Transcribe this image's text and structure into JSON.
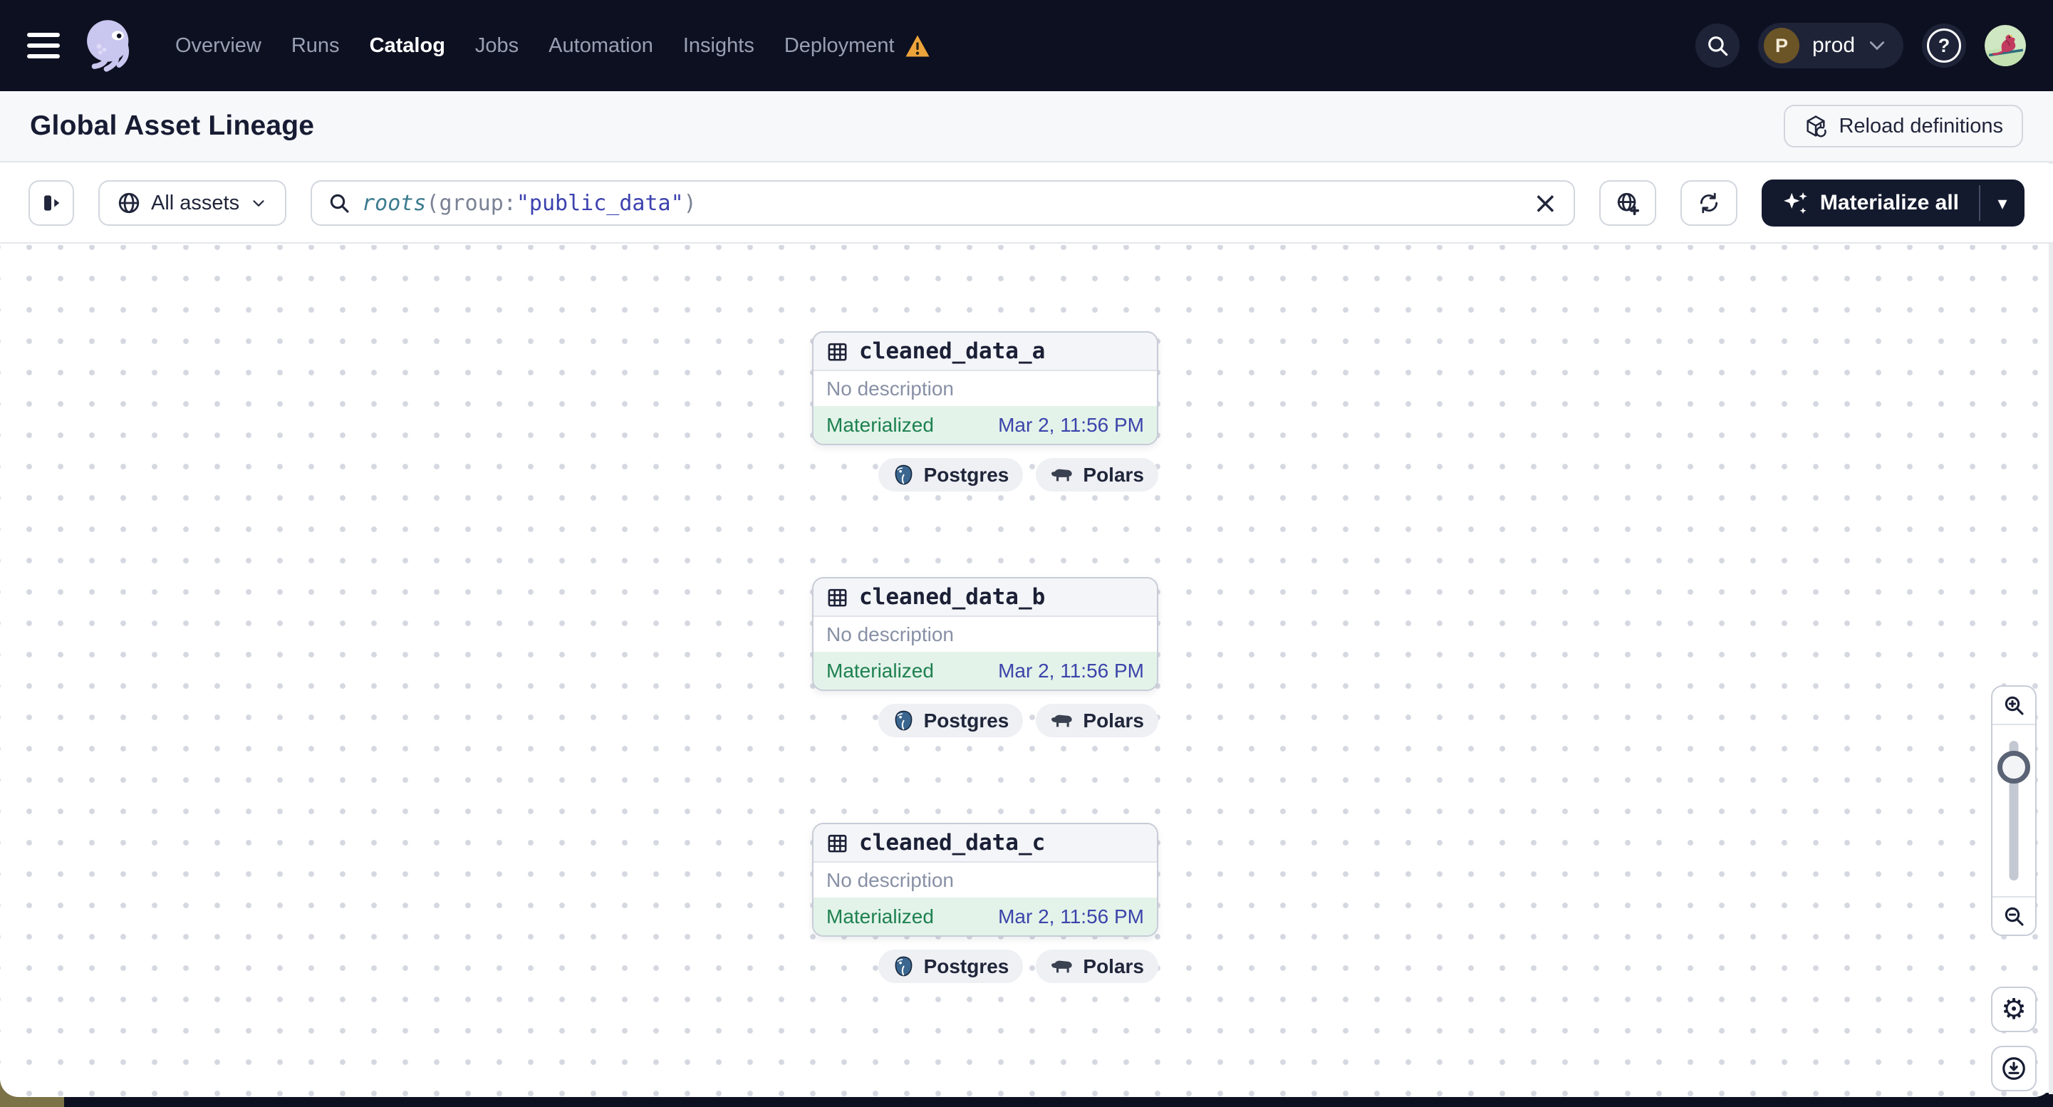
{
  "nav": {
    "items": [
      {
        "label": "Overview"
      },
      {
        "label": "Runs"
      },
      {
        "label": "Catalog"
      },
      {
        "label": "Jobs"
      },
      {
        "label": "Automation"
      },
      {
        "label": "Insights"
      },
      {
        "label": "Deployment"
      }
    ],
    "active_item": "Catalog",
    "environment": {
      "badge": "P",
      "label": "prod"
    }
  },
  "header": {
    "title": "Global Asset Lineage",
    "reload_label": "Reload definitions"
  },
  "toolbar": {
    "filter_label": "All assets",
    "search": {
      "fn": "roots",
      "open": "(",
      "key": "group",
      "colon": ":",
      "value": "\"public_data\"",
      "close": ")"
    },
    "materialize_label": "Materialize all"
  },
  "assets": [
    {
      "name": "cleaned_data_a",
      "description": "No description",
      "status": "Materialized",
      "timestamp": "Mar 2, 11:56 PM",
      "tags": [
        "Postgres",
        "Polars"
      ]
    },
    {
      "name": "cleaned_data_b",
      "description": "No description",
      "status": "Materialized",
      "timestamp": "Mar 2, 11:56 PM",
      "tags": [
        "Postgres",
        "Polars"
      ]
    },
    {
      "name": "cleaned_data_c",
      "description": "No description",
      "status": "Materialized",
      "timestamp": "Mar 2, 11:56 PM",
      "tags": [
        "Postgres",
        "Polars"
      ]
    }
  ],
  "icons": {
    "close": "×",
    "caret_down": "▾",
    "gear": "⚙",
    "help": "?"
  },
  "colors": {
    "navbar_bg": "#0d1020",
    "status_green": "#1e8150",
    "timestamp_blue": "#3c44ab",
    "warning_orange": "#eea43b",
    "logo_lavender": "#c9c7ef",
    "footer_green_bg": "#e3f3e9"
  }
}
